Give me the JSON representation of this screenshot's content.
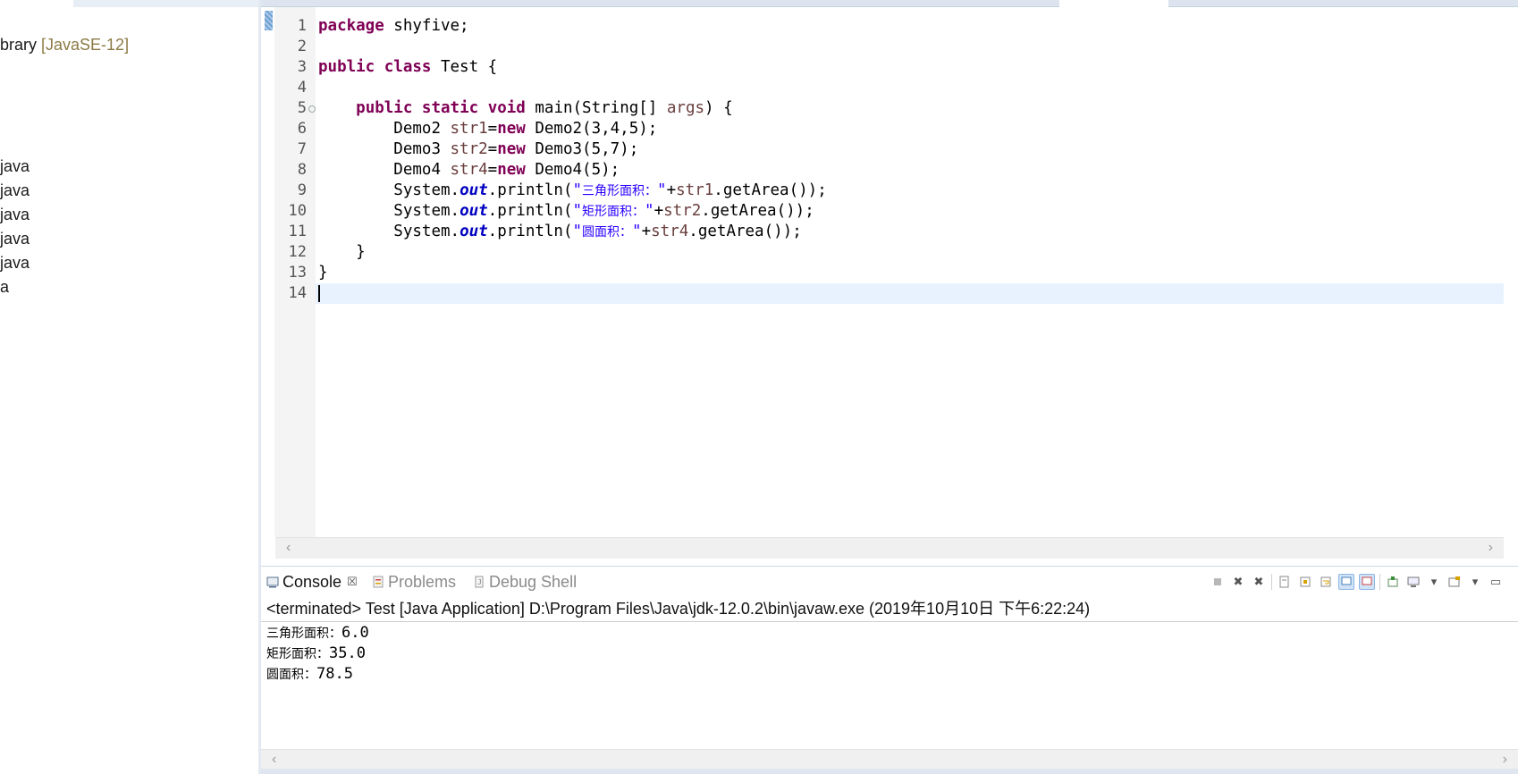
{
  "explorer": {
    "items": [
      {
        "label": "brary",
        "suffix": " [JavaSE-12]"
      },
      {
        "label": "java",
        "suffix": ""
      },
      {
        "label": "java",
        "suffix": ""
      },
      {
        "label": "java",
        "suffix": ""
      },
      {
        "label": "java",
        "suffix": ""
      },
      {
        "label": "java",
        "suffix": ""
      },
      {
        "label": "a",
        "suffix": ""
      }
    ]
  },
  "editor": {
    "line_numbers": [
      "1",
      "2",
      "3",
      "4",
      "5",
      "6",
      "7",
      "8",
      "9",
      "10",
      "11",
      "12",
      "13",
      "14"
    ],
    "code": {
      "l1": {
        "kw": "package",
        "rest": " shyfive;"
      },
      "l3": {
        "kw1": "public",
        "kw2": "class",
        "rest": " Test {"
      },
      "l5": {
        "indent": "    ",
        "kw1": "public",
        "kw2": "static",
        "kw3": "void",
        "mid": " main(String[] ",
        "var": "args",
        "rest": ") {"
      },
      "l6": {
        "indent": "        ",
        "type": "Demo2 ",
        "var": "str1",
        "eq": "=",
        "kw": "new",
        "rest": " Demo2(3,4,5);"
      },
      "l7": {
        "indent": "        ",
        "type": "Demo3 ",
        "var": "str2",
        "eq": "=",
        "kw": "new",
        "rest": " Demo3(5,7);"
      },
      "l8": {
        "indent": "        ",
        "type": "Demo4 ",
        "var": "str4",
        "eq": "=",
        "kw": "new",
        "rest": " Demo4(5);"
      },
      "l9": {
        "indent": "        ",
        "sys": "System.",
        "fld": "out",
        "call": ".println(",
        "q1": "\"",
        "cjk": "三角形面积：",
        "q2": "\"",
        "plus": "+",
        "var": "str1",
        "tail": ".getArea());"
      },
      "l10": {
        "indent": "        ",
        "sys": "System.",
        "fld": "out",
        "call": ".println(",
        "q1": "\"",
        "cjk": "矩形面积：",
        "q2": "\"",
        "plus": "+",
        "var": "str2",
        "tail": ".getArea());"
      },
      "l11": {
        "indent": "        ",
        "sys": "System.",
        "fld": "out",
        "call": ".println(",
        "q1": "\"",
        "cjk": "圆面积：",
        "q2": "\"",
        "plus": "+",
        "var": "str4",
        "tail": ".getArea());"
      },
      "l12": {
        "text": "    }"
      },
      "l13": {
        "text": "}"
      }
    }
  },
  "console": {
    "tabs": [
      {
        "label": "Console",
        "icon": "console-icon"
      },
      {
        "label": "Problems",
        "icon": "problems-icon"
      },
      {
        "label": "Debug Shell",
        "icon": "debug-shell-icon"
      }
    ],
    "close_glyph": "☒",
    "status": "<terminated> Test [Java Application] D:\\Program Files\\Java\\jdk-12.0.2\\bin\\javaw.exe (2019年10月10日 下午6:22:24)",
    "output": [
      {
        "label": "三角形面积：",
        "value": "6.0"
      },
      {
        "label": "矩形面积：",
        "value": "35.0"
      },
      {
        "label": "圆面积：",
        "value": "78.5"
      }
    ]
  },
  "colors": {
    "keyword": "#7f0055",
    "string": "#2a00ff",
    "field": "#0000c0",
    "local_var": "#6a3e3e",
    "current_line": "#e8f2fe",
    "library_suffix": "#8b7a44"
  }
}
